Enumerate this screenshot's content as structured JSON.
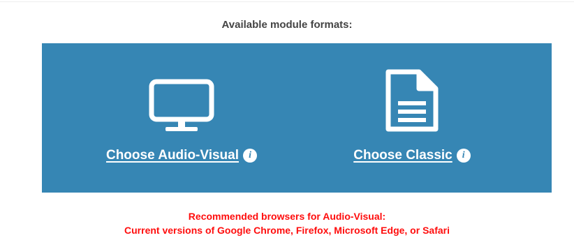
{
  "heading": "Available module formats:",
  "options": [
    {
      "label": "Choose Audio-Visual",
      "icon": "monitor-icon",
      "info_icon": "info-icon",
      "info_glyph": "i"
    },
    {
      "label": "Choose Classic",
      "icon": "document-icon",
      "info_icon": "info-icon",
      "info_glyph": "i"
    }
  ],
  "notice": {
    "line1": "Recommended browsers for Audio-Visual:",
    "line2": "Current versions of Google Chrome, Firefox, Microsoft Edge, or Safari"
  },
  "colors": {
    "panel": "#3686b4",
    "notice": "#ff0d0d",
    "heading": "#444444",
    "icon": "#ffffff"
  }
}
